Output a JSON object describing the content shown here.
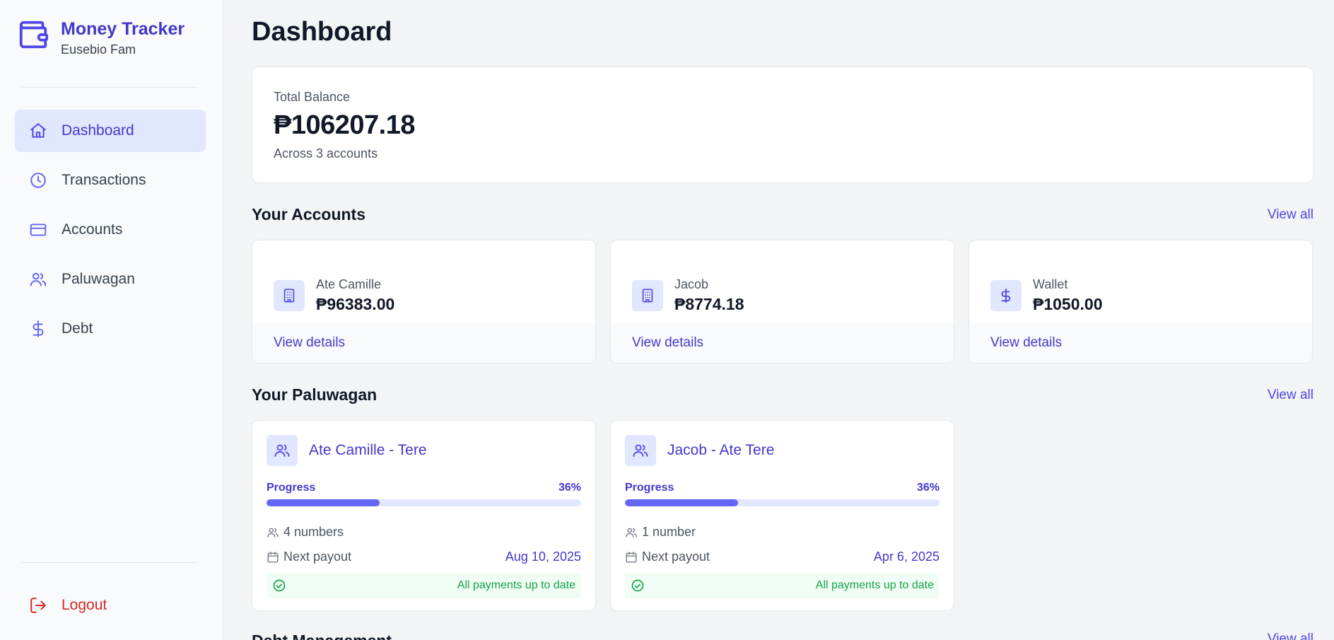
{
  "brand": {
    "title": "Money Tracker",
    "subtitle": "Eusebio Fam",
    "icon": "wallet-icon"
  },
  "nav": [
    {
      "label": "Dashboard",
      "icon": "home-icon",
      "active": true
    },
    {
      "label": "Transactions",
      "icon": "clock-icon",
      "active": false
    },
    {
      "label": "Accounts",
      "icon": "credit-card-icon",
      "active": false
    },
    {
      "label": "Paluwagan",
      "icon": "users-icon",
      "active": false
    },
    {
      "label": "Debt",
      "icon": "dollar-icon",
      "active": false
    }
  ],
  "logout": {
    "label": "Logout",
    "icon": "logout-icon"
  },
  "page": {
    "title": "Dashboard"
  },
  "balance": {
    "label": "Total Balance",
    "value": "₱106207.18",
    "sub": "Across 3 accounts"
  },
  "accounts_section": {
    "title": "Your Accounts",
    "view_all": "View all"
  },
  "accounts": [
    {
      "name": "Ate Camille",
      "amount": "₱96383.00",
      "icon": "building-icon",
      "link": "View details"
    },
    {
      "name": "Jacob",
      "amount": "₱8774.18",
      "icon": "building-icon",
      "link": "View details"
    },
    {
      "name": "Wallet",
      "amount": "₱1050.00",
      "icon": "dollar-icon",
      "link": "View details"
    }
  ],
  "paluwagan_section": {
    "title": "Your Paluwagan",
    "view_all": "View all"
  },
  "paluwagan": [
    {
      "name": "Ate Camille - Tere",
      "progress_label": "Progress",
      "progress_text": "36%",
      "progress": 36,
      "members": "4 numbers",
      "payout_label": "Next payout",
      "payout_date": "Aug 10, 2025",
      "status": "All payments up to date"
    },
    {
      "name": "Jacob - Ate Tere",
      "progress_label": "Progress",
      "progress_text": "36%",
      "progress": 36,
      "members": "1 number",
      "payout_label": "Next payout",
      "payout_date": "Apr 6, 2025",
      "status": "All payments up to date"
    }
  ],
  "debt_section": {
    "title": "Debt Management",
    "view_all": "View all"
  },
  "colors": {
    "accent": "#4f46e5",
    "accent_light": "#e0e7ff",
    "danger": "#dc2626",
    "success": "#16a34a"
  }
}
